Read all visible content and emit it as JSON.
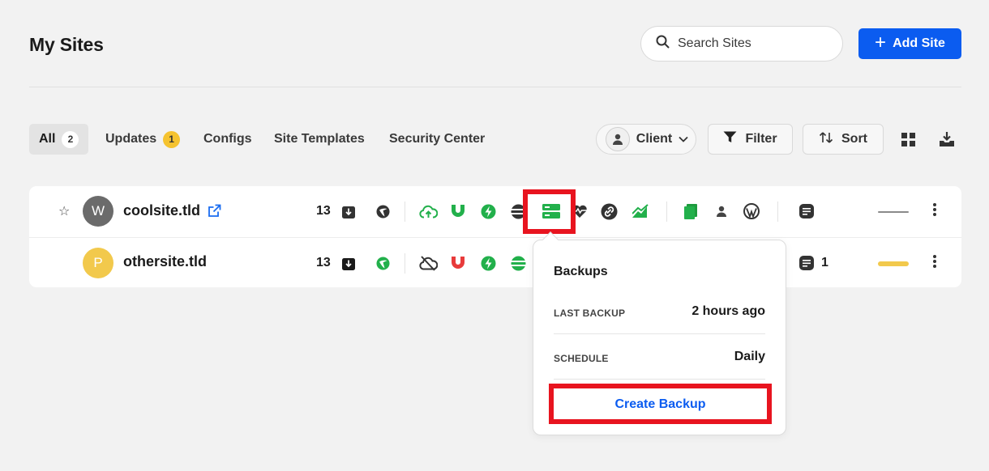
{
  "header": {
    "title": "My Sites",
    "search_placeholder": "Search Sites",
    "add_site_label": "Add Site"
  },
  "tabs": [
    {
      "label": "All",
      "count": "2",
      "active": true
    },
    {
      "label": "Updates",
      "count": "1"
    },
    {
      "label": "Configs"
    },
    {
      "label": "Site Templates"
    },
    {
      "label": "Security Center"
    }
  ],
  "toolbar": {
    "client_label": "Client",
    "filter_label": "Filter",
    "sort_label": "Sort"
  },
  "sites": [
    {
      "initial": "W",
      "name": "coolsite.tld",
      "updates_count": "13",
      "avatar_color": "#6b6b6b",
      "health": "#8a8a8a"
    },
    {
      "initial": "P",
      "name": "othersite.tld",
      "updates_count": "13",
      "notes_count": "1",
      "avatar_color": "#f2c94c",
      "health": "#f2c94c"
    }
  ],
  "popover": {
    "title": "Backups",
    "last_backup_label": "LAST BACKUP",
    "last_backup_value": "2 hours ago",
    "schedule_label": "SCHEDULE",
    "schedule_value": "Daily",
    "create_label": "Create Backup"
  },
  "colors": {
    "accent": "#0b5cf0",
    "green": "#22b04b",
    "red": "#e83b3b",
    "highlight": "#e8141f"
  }
}
